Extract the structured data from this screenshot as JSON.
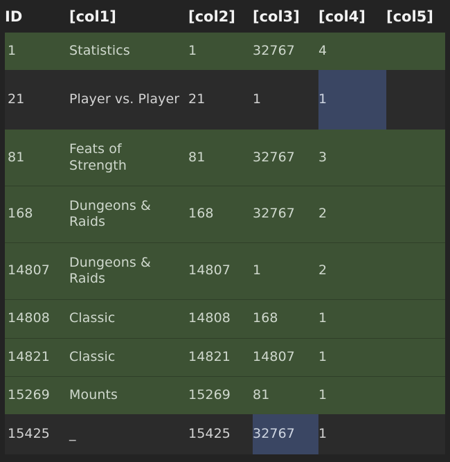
{
  "table": {
    "columns": [
      {
        "key": "id",
        "label": "ID"
      },
      {
        "key": "col1",
        "label": "[col1]"
      },
      {
        "key": "col2",
        "label": "[col2]"
      },
      {
        "key": "col3",
        "label": "[col3]"
      },
      {
        "key": "col4",
        "label": "[col4]"
      },
      {
        "key": "col5",
        "label": "[col5]"
      }
    ],
    "rows": [
      {
        "id": "1",
        "col1": "Statistics",
        "col2": "1",
        "col3": "32767",
        "col4": "4",
        "col5": ""
      },
      {
        "id": "21",
        "col1": "Player vs. Player",
        "col2": "21",
        "col3": "1",
        "col4": "1",
        "col5": ""
      },
      {
        "id": "81",
        "col1": "Feats of Strength",
        "col2": "81",
        "col3": "32767",
        "col4": "3",
        "col5": ""
      },
      {
        "id": "168",
        "col1": "Dungeons & Raids",
        "col2": "168",
        "col3": "32767",
        "col4": "2",
        "col5": ""
      },
      {
        "id": "14807",
        "col1": "Dungeons & Raids",
        "col2": "14807",
        "col3": "1",
        "col4": "2",
        "col5": ""
      },
      {
        "id": "14808",
        "col1": "Classic",
        "col2": "14808",
        "col3": "168",
        "col4": "1",
        "col5": ""
      },
      {
        "id": "14821",
        "col1": "Classic",
        "col2": "14821",
        "col3": "14807",
        "col4": "1",
        "col5": ""
      },
      {
        "id": "15269",
        "col1": "Mounts",
        "col2": "15269",
        "col3": "81",
        "col4": "1",
        "col5": ""
      },
      {
        "id": "15425",
        "col1": "_",
        "col2": "15425",
        "col3": "32767",
        "col4": "1",
        "col5": ""
      }
    ]
  },
  "colors": {
    "page_background": "#232323",
    "header_background": "#232323",
    "header_text": "#f2f2f2",
    "row_green_background": "#3d5234",
    "row_green_text": "#cfd8cd",
    "row_dark_background": "#2b2b2b",
    "row_dark_text": "#d4d4d4",
    "cell_highlight_background": "#3a4663",
    "cell_highlight_text": "#cfd6e2"
  }
}
